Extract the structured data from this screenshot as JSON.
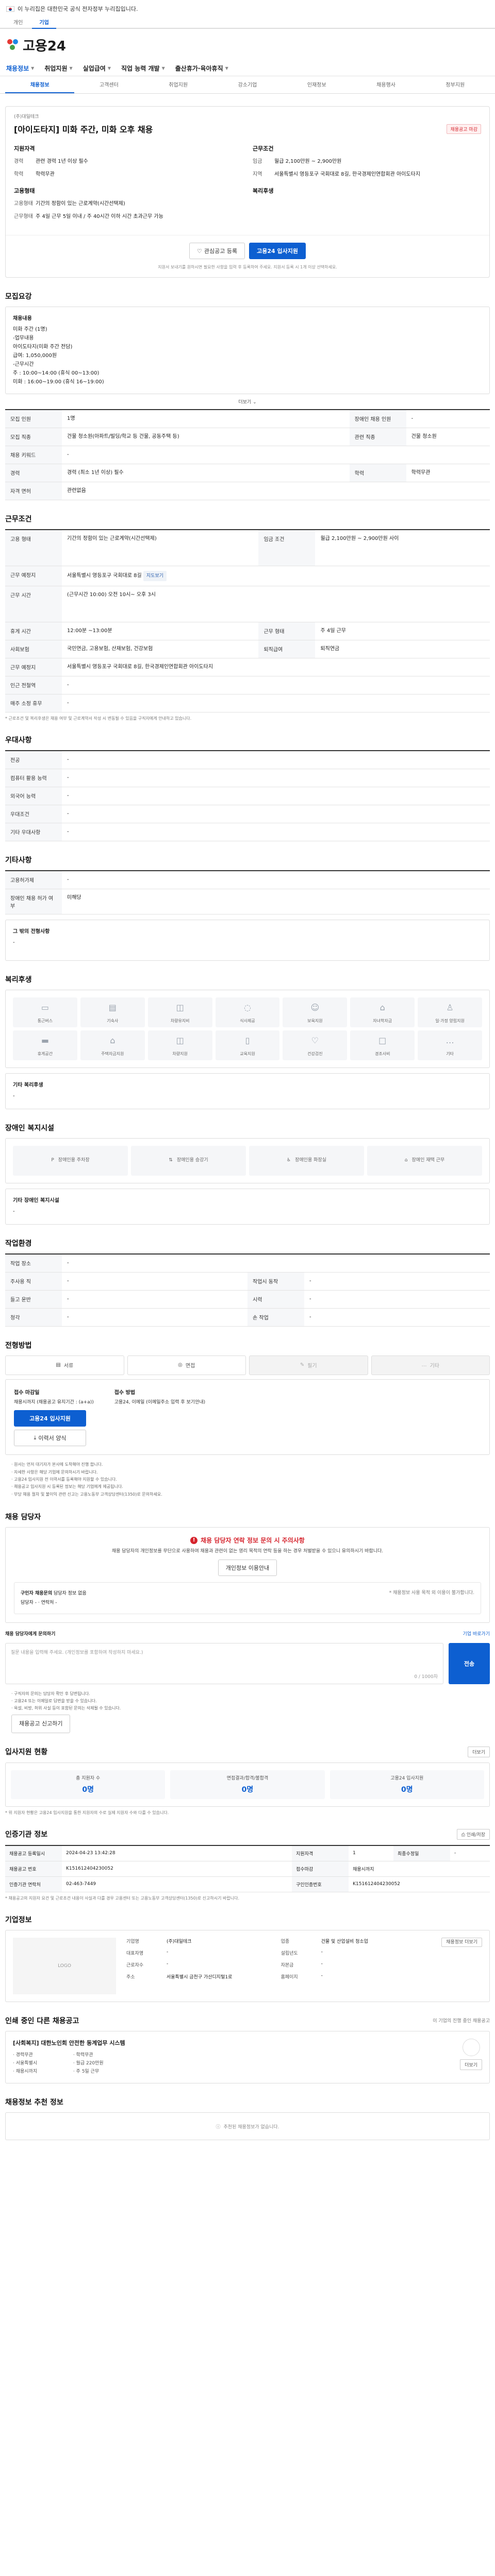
{
  "gov_banner": "이 누리집은 대한민국 공식 전자정부 누리집입니다.",
  "util_tabs": [
    "개인",
    "기업"
  ],
  "logo": "고용24",
  "gnb": [
    "채용정보",
    "취업지원",
    "실업급여",
    "직업 능력 개발",
    "출산휴가·육아휴직"
  ],
  "subtabs": [
    "채용정보",
    "고객센터",
    "취업지원",
    "강소기업",
    "인재정보",
    "채용행사",
    "정부지원"
  ],
  "job": {
    "company": "(주)대일테크",
    "title": "[아이도타지] 미화 주간, 미화 오후 채용",
    "badge": "채용공고 마감",
    "qual_h": "지원자격",
    "qual": [
      {
        "k": "경력",
        "v": "관련 경력 1년 이상 필수"
      },
      {
        "k": "학력",
        "v": "학력무관"
      }
    ],
    "emp_h": "고용형태",
    "emp": [
      {
        "k": "고용형태",
        "v": "기간의 정함이 있는 근로계약(시간선택제)"
      },
      {
        "k": "근무형태",
        "v": "주 4일 근무 5일 이내 / 주 40시간 이하 시간 초과근무 가능"
      }
    ],
    "cond_h": "근무조건",
    "cond": [
      {
        "k": "임금",
        "v": "월급 2,100만원 ~ 2,900만원"
      },
      {
        "k": "지역",
        "v": "서울특별시 영등포구 국회대로 8길, 한국경제인연합회관 아이도타지"
      }
    ],
    "benefit_h": "복리후생",
    "benefit": []
  },
  "actions": {
    "interest": "관심공고 등록",
    "apply": "고용24 입사지원",
    "note": "지원서 보내기를 원하시면 필요한 사항을 입력 후 등록하여 주세요. 지원서 등록 시 1개 이상 선택하세요."
  },
  "recruit": {
    "title": "모집요강",
    "box_title": "채용내용",
    "box_lines": [
      "미화 주간 (1명)",
      "-업무내용",
      " 아이도타지(미화 주간 전담)",
      "  급여: 1,050,000원",
      "-근무시간",
      "  주 : 10:00~14:00 (휴식 00~13:00)",
      "  미화 : 16:00~19:00 (휴식 16~19:00)"
    ],
    "more": "더보기",
    "rows": [
      {
        "k": "모집 인원",
        "v": "1명",
        "k2": "장애인 채용 인원",
        "v2": "-"
      },
      {
        "k": "모집 직종",
        "v": "건물 청소원(아파트/빌딩/학교 등 건물, 공동주택 등)",
        "k2": "관련 직종",
        "v2": "건물 청소원"
      },
      {
        "k": "채용 키워드",
        "v": "-",
        "k2": "",
        "v2": ""
      },
      {
        "k": "경력",
        "v": "경력 (최소 1년 이상) 필수",
        "k2": "학력",
        "v2": "학력무관"
      },
      {
        "k": "자격 면허",
        "v": "관련없음",
        "k2": "",
        "v2": ""
      }
    ]
  },
  "work": {
    "title": "근무조건",
    "rows": [
      {
        "k": "고용 형태",
        "v": "기간의 정함이 있는 근로계약(시간선택제)",
        "k2": "임금 조건",
        "v2": "월급 2,100만원 ~ 2,900만원 사이"
      },
      {
        "k": "근무 예정지",
        "v": "서울특별시 영등포구 국회대로 8길",
        "k2": "",
        "v2": ""
      },
      {
        "k": "근무 시간",
        "v": "(근무시간 10:00) 오전 10시~ 오후 3시",
        "k2": "",
        "v2": ""
      },
      {
        "k": "휴게 시간",
        "v": "12:00분 ~13:00분",
        "k2": "근무 형태",
        "v2": "주 4일 근무"
      },
      {
        "k": "사회보험",
        "v": "국민연금, 고용보험, 산재보험, 건강보험",
        "k2": "퇴직급여",
        "v2": "퇴직연금"
      },
      {
        "k": "근무 예정지",
        "v": "서울특별시 영등포구 국회대로 8길, 한국경제인연합회관 아이도타지",
        "k2": "",
        "v2": ""
      },
      {
        "k": "인근 전철역",
        "v": "-",
        "k2": "",
        "v2": ""
      },
      {
        "k": "매주 소정 휴무",
        "v": "-",
        "k2": "",
        "v2": ""
      }
    ],
    "map_btn": "지도보기",
    "note": "* 근로조건 및 복리후생은 채용 여부 및 근로계약서 작성 시 변동될 수 있음을 구직자에게 안내하고 있습니다."
  },
  "prefer": {
    "title": "우대사항",
    "rows": [
      {
        "k": "전공",
        "v": "-"
      },
      {
        "k": "컴퓨터 활용 능력",
        "v": "-"
      },
      {
        "k": "외국어 능력",
        "v": "-"
      },
      {
        "k": "우대조건",
        "v": "-"
      },
      {
        "k": "기타 우대사항",
        "v": "-"
      }
    ]
  },
  "etc": {
    "title": "기타사항",
    "rows": [
      {
        "k": "고용허가제",
        "v": "-"
      },
      {
        "k": "장애인 채용 허가 여부",
        "v": "미해당"
      }
    ],
    "box_title": "그 밖의 전형사항",
    "box_v": "-"
  },
  "welfare": {
    "title": "복리후생",
    "items": [
      "통근버스",
      "기숙사",
      "차량유지비",
      "식사제공",
      "보육지원",
      "자녀학자금",
      "일·가정 양립지원",
      "휴게공간",
      "주택자금지원",
      "차량지원",
      "교육지원",
      "건강검진",
      "경조사비",
      "기타"
    ],
    "box_title": "기타 복리후생",
    "box_v": "-"
  },
  "disabled": {
    "title": "장애인 복지시설",
    "items": [
      "장애인용 주차장",
      "장애인용 승강기",
      "장애인용 화장실",
      "장애인 재택 근무"
    ],
    "box_title": "기타 장애인 복지시설",
    "box_v": "-"
  },
  "env": {
    "title": "작업환경",
    "rows": [
      {
        "k": "작업 장소",
        "v": "-",
        "k2": "",
        "v2": ""
      },
      {
        "k": "주사용 직",
        "v": "-",
        "k2": "작업시 동작",
        "v2": "-"
      },
      {
        "k": "들고 운반",
        "v": "-",
        "k2": "시력",
        "v2": "-"
      },
      {
        "k": "청각",
        "v": "-",
        "k2": "손 작업",
        "v2": "-"
      }
    ]
  },
  "method": {
    "title": "전형방법",
    "items": [
      "서류",
      "면접",
      "필기",
      "기타"
    ],
    "apply_h": "접수 마감일",
    "apply_v": "채용시까지 (채용공고 유지기간 : (a+a))",
    "apply_btn": "고용24 입사지원",
    "doc_btn": "이력서 양식",
    "method_h": "접수 방법",
    "method_v": "고용24, 이메일 (이메일주소 입력 후 보기안내)",
    "bullets": [
      "· 원서는 먼저 대기자가 본사에 도착해야 진행 합니다.",
      "· 자세한 사항은 해당 기업에 문의하시기 바랍니다.",
      "· 고용24 입사지원 전 이력서를 등록해야 지원할 수 있습니다.",
      "· 채용공고 입사지원 시 등록된 정보는 해당 기업에게 제공됩니다.",
      "· 부당 채용 절차 및 불이익 관련 신고는 고용노동부 고객상담센터(1350)로 문의하세요."
    ]
  },
  "contact": {
    "title": "채용 담당자",
    "notice_title": "채용 담당자 연락 정보 문의 시 주의사항",
    "notice_text": "채용 담당자의 개인정보를 무단으로 사용하여 채용과 관련이 없는 영리 목적의 연락 등을 하는 경우 처벌받을 수 있으니 유의하시기 바랍니다.",
    "info_btn": "개인정보 이용안내",
    "dept_k": "구인자 채용문의",
    "dept_v": "담당자 정보 없음",
    "name_k": "담당자",
    "name_v": "-",
    "phone_k": "연락처",
    "phone_v": "-",
    "inner_note": "* 채용정보 사용 목적 외 이용이 불가합니다.",
    "qa_title": "채용 담당자에게 문의하기",
    "qa_hint": "기업 바로가기",
    "qa_placeholder": "질문 내용을 입력해 주세요. (개인정보를 포함하여 작성하지 마세요.)",
    "qa_counter": "0 / 1000자",
    "qa_btn": "전송",
    "bullets": [
      "· 구직자의 문의는 담당자 확인 후 답변됩니다.",
      "· 고용24 또는 이메일로 답변을 받을 수 있습니다.",
      "· 욕설, 비방, 허위 사실 등이 포함된 문의는 삭제될 수 있습니다."
    ],
    "report_btn": "채용공고 신고하기"
  },
  "stats": {
    "title": "입사지원 현황",
    "more": "더보기",
    "items": [
      {
        "label": "총 지원자 수",
        "value": "0명"
      },
      {
        "label": "면접결과/합격/불합격",
        "value": "0명"
      },
      {
        "label": "고용24 입사지원",
        "value": "0명"
      }
    ],
    "note": "* 위 지원자 현황은 고용24 입사지원을 통한 지원자의 수로 실제 지원자 수와 다를 수 있습니다."
  },
  "info": {
    "title": "인증기관 정보",
    "btn": "인쇄/저장",
    "rows": [
      {
        "k": "채용공고 등록일시",
        "v": "2024-04-23 13:42:28",
        "k2": "지원자격",
        "v2": "1",
        "k3": "최종수정일",
        "v3": "-"
      },
      {
        "k": "채용공고 번호",
        "v": "K151612404230052",
        "k2": "접수마감",
        "v2": "채용시까지",
        "k3": "",
        "v3": ""
      },
      {
        "k": "인증기관 연락처",
        "v": "02-463-7449",
        "k2": "구인인증번호",
        "v2": "K151612404230052",
        "k3": "",
        "v3": ""
      }
    ],
    "note": "* 채용공고의 지원자 요건 및 근로조건 내용이 사실과 다를 경우 고용센터 또는 고용노동부 고객상담센터(1350)로 신고하시기 바랍니다."
  },
  "company": {
    "title": "기업정보",
    "btn": "채용정보 더보기",
    "logo_ph": "LOGO",
    "fields": [
      {
        "k": "기업명",
        "v": "(주)대일테크"
      },
      {
        "k": "업종",
        "v": "건물 및 산업설비 청소업"
      },
      {
        "k": "대표자명",
        "v": "-"
      },
      {
        "k": "설립년도",
        "v": "-"
      },
      {
        "k": "근로자수",
        "v": "-"
      },
      {
        "k": "자본금",
        "v": "-"
      },
      {
        "k": "주소",
        "v": "서울특별시 금천구 가산디지털1로"
      },
      {
        "k": "홈페이지",
        "v": "-"
      }
    ]
  },
  "related": {
    "title": "인쇄 중인 다른 채용공고",
    "sub": "이 기업의 진행 중인 채용공고",
    "item_title": "[사회복지] 대한노인회 안전한 동계업무 시스템",
    "meta": [
      "· 경력무관",
      "· 학력무관",
      "· 서울특별시",
      "· 월급 220만원",
      "· 채용시까지",
      "· 주 5일 근무"
    ],
    "more": "더보기"
  },
  "recommend": {
    "title": "채용정보 추천 정보",
    "empty": "추천된 채용정보가 없습니다."
  }
}
